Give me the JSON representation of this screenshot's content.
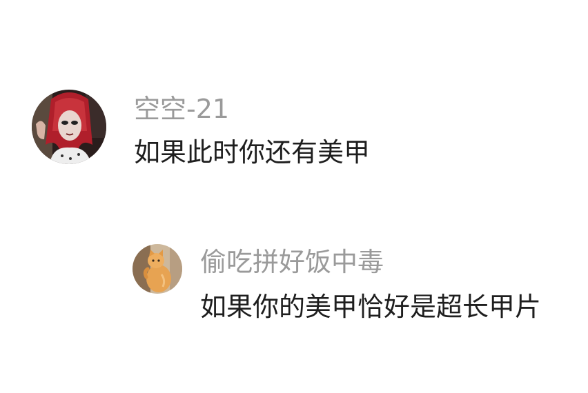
{
  "comments": [
    {
      "username": "空空-21",
      "text": "如果此时你还有美甲",
      "avatar_icon": "person-red-hair-avatar"
    }
  ],
  "replies": [
    {
      "username": "偷吃拼好饭中毒",
      "text": "如果你的美甲恰好是超长甲片",
      "avatar_icon": "orange-cat-avatar"
    }
  ],
  "colors": {
    "username": "#9a9a9a",
    "text": "#1e1e1e",
    "background": "#ffffff"
  }
}
